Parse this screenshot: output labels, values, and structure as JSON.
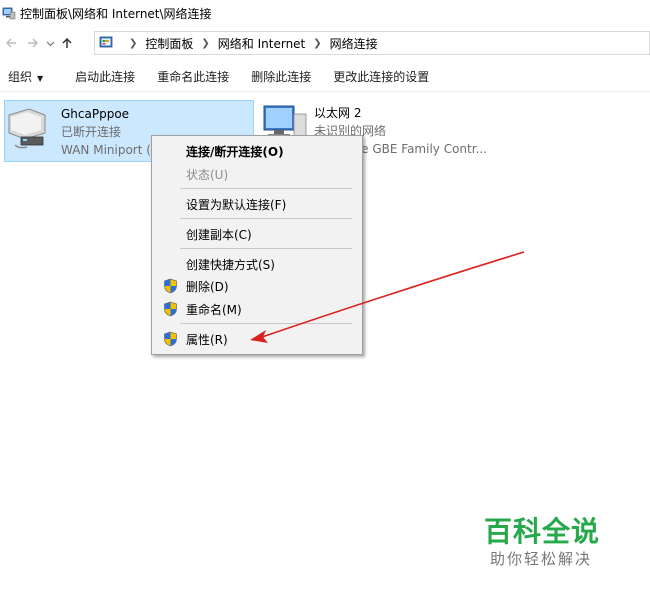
{
  "window": {
    "title": "控制面板\\网络和 Internet\\网络连接"
  },
  "address": {
    "crumbs": [
      "控制面板",
      "网络和 Internet",
      "网络连接"
    ]
  },
  "toolbar": {
    "organize": "组织",
    "start_connection": "启动此连接",
    "rename_connection": "重命名此连接",
    "delete_connection": "删除此连接",
    "change_settings": "更改此连接的设置"
  },
  "connections": [
    {
      "name": "GhcaPppoe",
      "status": "已断开连接",
      "device": "WAN Miniport (",
      "selected": true
    },
    {
      "name": "以太网 2",
      "status": "未识别的网络",
      "device": "PCIe GBE Family Contr..."
    }
  ],
  "context_menu": {
    "items": [
      {
        "label": "连接/断开连接(O)",
        "bold": true
      },
      {
        "label": "状态(U)",
        "disabled": true
      },
      {
        "label": "设置为默认连接(F)"
      },
      {
        "label": "创建副本(C)"
      },
      {
        "label": "创建快捷方式(S)"
      },
      {
        "label": "删除(D)",
        "shield": true
      },
      {
        "label": "重命名(M)",
        "shield": true
      },
      {
        "label": "属性(R)",
        "shield": true
      }
    ]
  },
  "colors": {
    "selection_bg": "#cce8ff",
    "annotation_arrow": "#d9211e",
    "watermark": "#27a84a"
  },
  "watermark": {
    "title": "百科全说",
    "subtitle": "助你轻松解决"
  }
}
